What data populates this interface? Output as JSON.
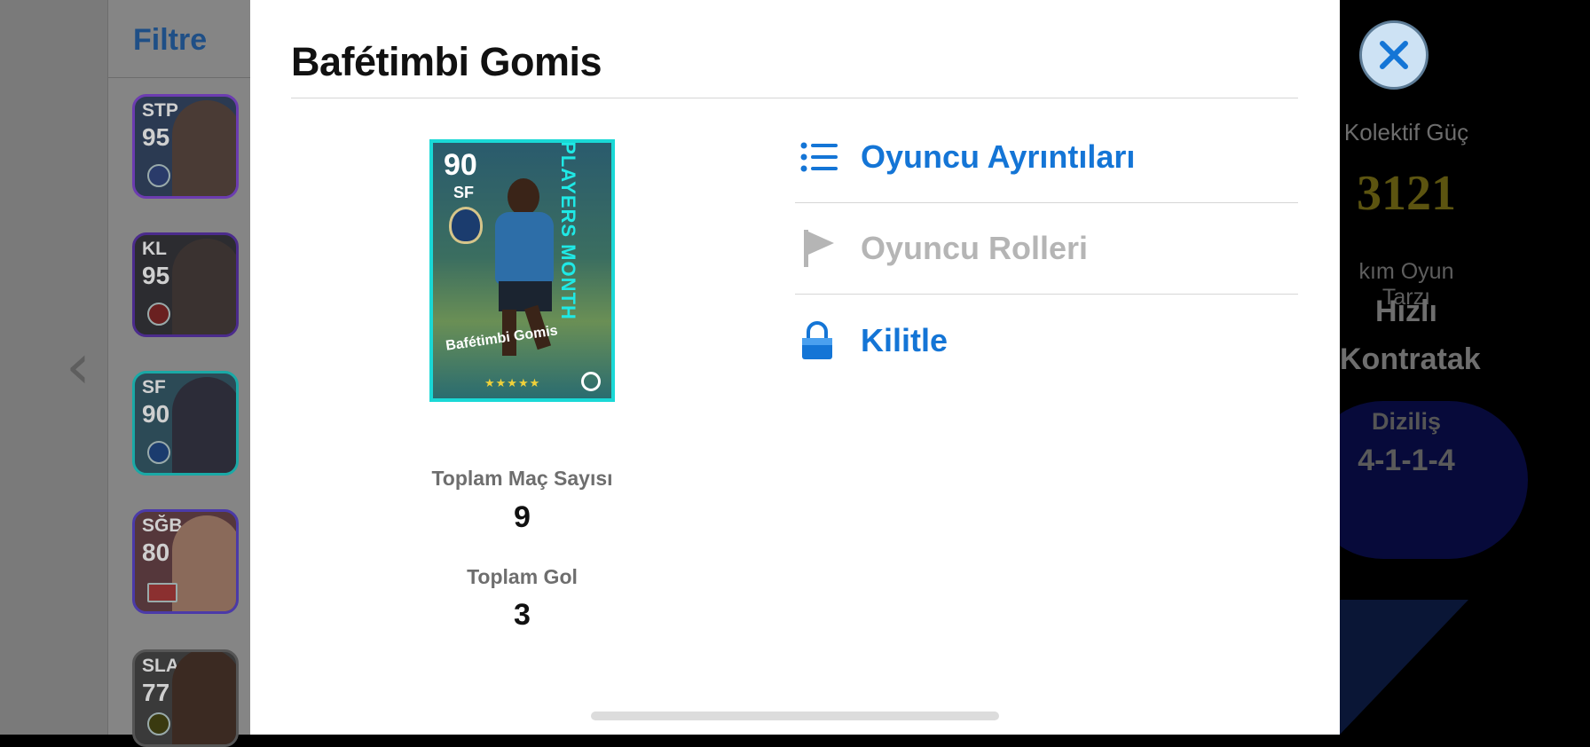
{
  "background": {
    "filter_label": "Filtre",
    "player_cards": [
      {
        "position": "STP",
        "rating": "95",
        "frame_color": "#6c3cb0",
        "bg": "#2b3a52"
      },
      {
        "position": "KL",
        "rating": "95",
        "frame_color": "#4b2b8c",
        "bg": "#2c2c30"
      },
      {
        "position": "SF",
        "rating": "90",
        "frame_color": "#1aa9a6",
        "bg": "#2c4a56"
      },
      {
        "position": "SĞB",
        "rating": "80",
        "frame_color": "#4b3aa8",
        "bg": "#55373b"
      },
      {
        "position": "SLA",
        "rating": "77",
        "frame_color": "#555555",
        "bg": "#3a3a3a"
      }
    ],
    "team_info": {
      "collective_power_label": "Kolektif Güç",
      "collective_power_value": "3121",
      "team_style_label": "kım Oyun Tarzı",
      "team_style_line1": "Hızlı",
      "team_style_line2": "Kontratak",
      "formation_label": "Diziliş",
      "formation_value": "4-1-1-4"
    }
  },
  "modal": {
    "title": "Bafétimbi Gomis",
    "card": {
      "rating": "90",
      "position": "SF",
      "name": "Bafétimbi Gomis",
      "banner": "PLAYERS MONTH",
      "stars": "★★★★★"
    },
    "stats": {
      "matches_label": "Toplam Maç Sayısı",
      "matches_value": "9",
      "goals_label": "Toplam Gol",
      "goals_value": "3"
    },
    "menu": [
      {
        "label": "Oyuncu Ayrıntıları",
        "icon": "list-icon",
        "state": "active"
      },
      {
        "label": "Oyuncu Rolleri",
        "icon": "flag-icon",
        "state": "disabled"
      },
      {
        "label": "Kilitle",
        "icon": "lock-icon",
        "state": "active"
      }
    ]
  },
  "colors": {
    "accent": "#1475d6",
    "disabled": "#b5b5b5",
    "card_frame": "#1ad8d6",
    "power_gold": "#5c5410"
  }
}
